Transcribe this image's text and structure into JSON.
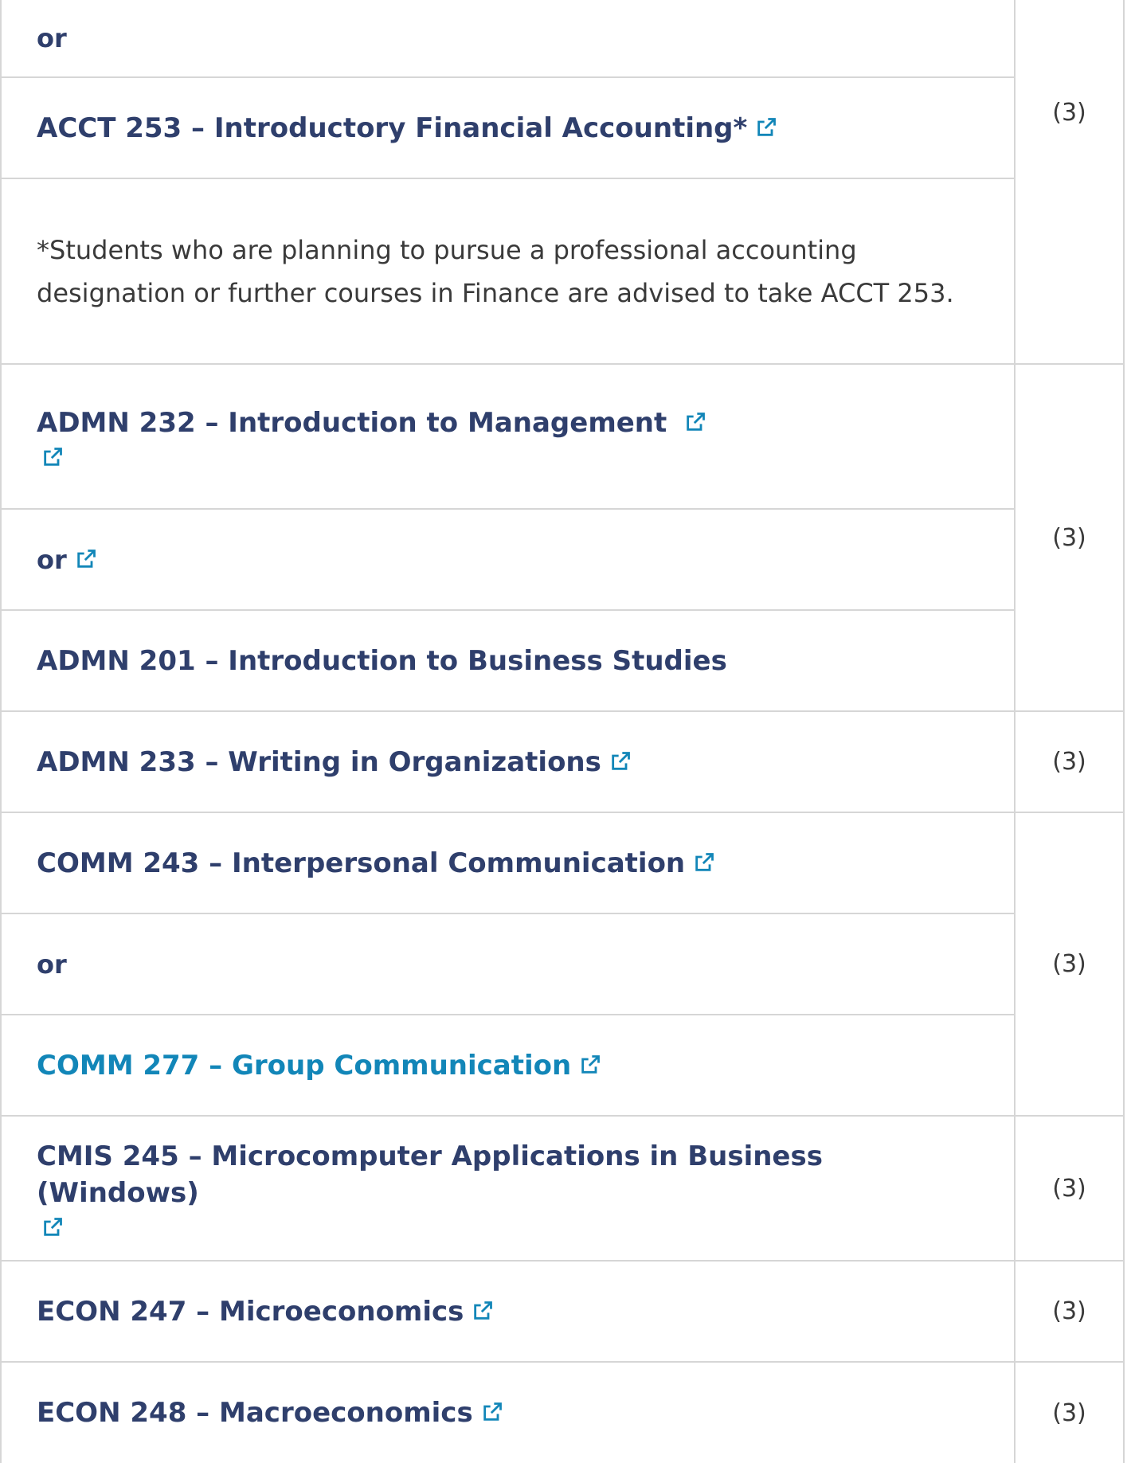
{
  "rows": {
    "or_top": "or",
    "acct253": "ACCT 253 – Introductory Financial Accounting*",
    "acct_credit": "(3)",
    "acct_note": "*Students who are planning to pursue a professional accounting designation or further courses in Finance are advised to take ACCT 253.",
    "admn232": "ADMN 232 – Introduction to Management",
    "or_mid": "or",
    "admn201": "ADMN 201 – Introduction to Business Studies",
    "admn_credit": "(3)",
    "admn233": "ADMN 233 – Writing in Organizations",
    "admn233_credit": "(3)",
    "comm243": "COMM 243 – Interpersonal Communication",
    "or_comm": "or",
    "comm277": "COMM 277 – Group Communication",
    "comm_credit": "(3)",
    "cmis245": "CMIS 245 – Microcomputer Applications in Business (Windows)",
    "cmis_credit": "(3)",
    "econ247": "ECON 247 – Microeconomics",
    "econ247_credit": "(3)",
    "econ248": "ECON 248 – Macroeconomics",
    "econ248_credit": "(3)"
  },
  "icons": {
    "external_link": "external-link-icon"
  },
  "colors": {
    "link": "#2f3f6c",
    "link_active": "#1286b8",
    "text": "#3a3a3a",
    "border": "#d6d6d6"
  }
}
